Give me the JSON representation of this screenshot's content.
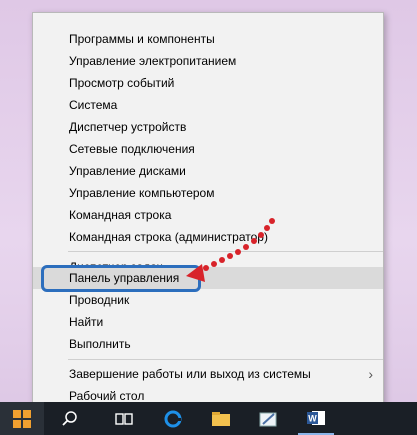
{
  "menu": {
    "items": [
      {
        "label": "Программы и компоненты"
      },
      {
        "label": "Управление электропитанием"
      },
      {
        "label": "Просмотр событий"
      },
      {
        "label": "Система"
      },
      {
        "label": "Диспетчер устройств"
      },
      {
        "label": "Сетевые подключения"
      },
      {
        "label": "Управление дисками"
      },
      {
        "label": "Управление компьютером"
      },
      {
        "label": "Командная строка"
      },
      {
        "label": "Командная строка (администратор)"
      },
      {
        "label": "Диспетчер задач"
      },
      {
        "label": "Панель управления",
        "highlighted": true
      },
      {
        "label": "Проводник"
      },
      {
        "label": "Найти"
      },
      {
        "label": "Выполнить"
      },
      {
        "label": "Завершение работы или выход из системы",
        "submenu": true
      },
      {
        "label": "Рабочий стол"
      }
    ],
    "highlight_color": "#dadada",
    "annotation_box_color": "#2c6ebd",
    "arrow_color": "#d8232a"
  },
  "taskbar": {
    "icons": [
      "windows-start-icon",
      "search-icon",
      "task-view-icon",
      "edge-icon",
      "file-explorer-icon",
      "paint-icon",
      "word-icon"
    ]
  }
}
